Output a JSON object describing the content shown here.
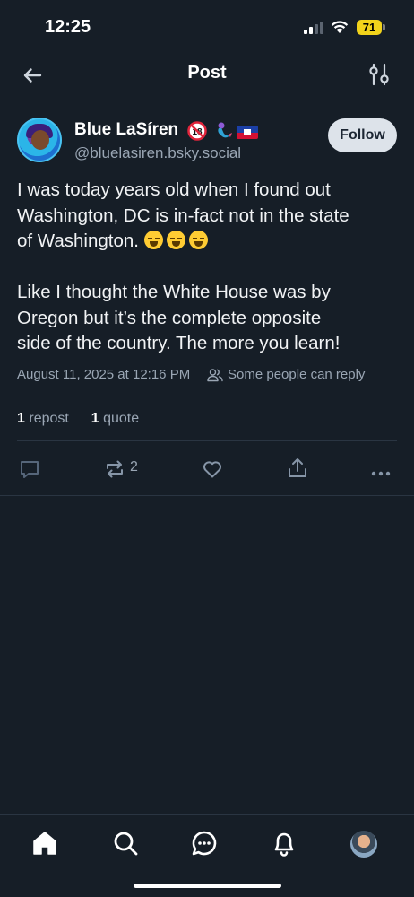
{
  "status_bar": {
    "time": "12:25",
    "battery": "71"
  },
  "header": {
    "title": "Post"
  },
  "post": {
    "author_name": "Blue LaSíren",
    "handle": "@bluelasiren.bsky.social",
    "follow_label": "Follow",
    "text_line1": "I was today years old when I found out",
    "text_line2": "Washington, DC is in-fact not in the state",
    "text_line3": "of Washington.",
    "text_line4": "Like I thought the White House was by",
    "text_line5": "Oregon but it’s the complete opposite",
    "text_line6": "side of the country. The more you learn!",
    "timestamp": "August 11, 2025 at 12:16 PM",
    "reply_setting": "Some people can reply",
    "repost_count": "1",
    "repost_label": "repost",
    "quote_count": "1",
    "quote_label": "quote",
    "action_repost_count": "2"
  },
  "icons": {
    "back": "arrow-left",
    "filter": "sliders",
    "reply": "speech-bubble",
    "repost": "repost-arrows",
    "like": "heart",
    "share": "share-up",
    "more": "ellipsis",
    "nav_home": "home",
    "nav_search": "search",
    "nav_chat": "chat",
    "nav_notifications": "bell"
  },
  "colors": {
    "background": "#161e27",
    "divider": "#2a3542",
    "muted_text": "#9aa6b4",
    "follow_bg": "#dde3ea",
    "battery": "#f2d31b"
  }
}
